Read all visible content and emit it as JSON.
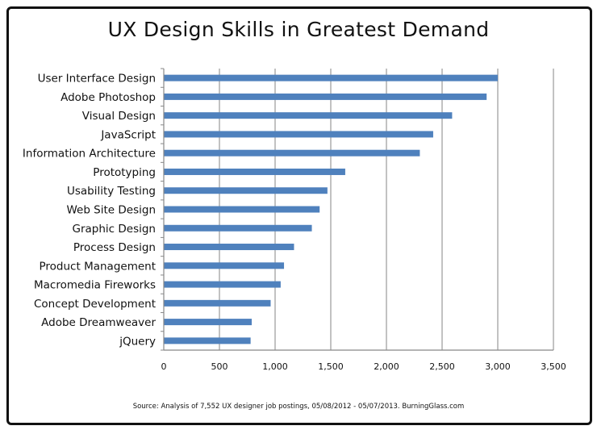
{
  "chart_data": {
    "type": "bar",
    "orientation": "horizontal",
    "title": "UX Design Skills in Greatest Demand",
    "source": "Source: Analysis of 7,552 UX designer job postings, 05/08/2012 - 05/07/2013. BurningGlass.com",
    "categories": [
      "User Interface Design",
      "Adobe Photoshop",
      "Visual Design",
      "JavaScript",
      "Information Architecture",
      "Prototyping",
      "Usability Testing",
      "Web Site Design",
      "Graphic Design",
      "Process Design",
      "Product Management",
      "Macromedia Fireworks",
      "Concept Development",
      "Adobe Dreamweaver",
      "jQuery"
    ],
    "values": [
      3000,
      2900,
      2590,
      2420,
      2300,
      1630,
      1470,
      1400,
      1330,
      1170,
      1080,
      1050,
      960,
      790,
      780
    ],
    "xlim": [
      0,
      3500
    ],
    "xticks": [
      "0",
      "500",
      "1,000",
      "1,500",
      "2,000",
      "2,500",
      "3,000",
      "3,500"
    ],
    "grid": true,
    "bar_color": "#4f81bd"
  }
}
